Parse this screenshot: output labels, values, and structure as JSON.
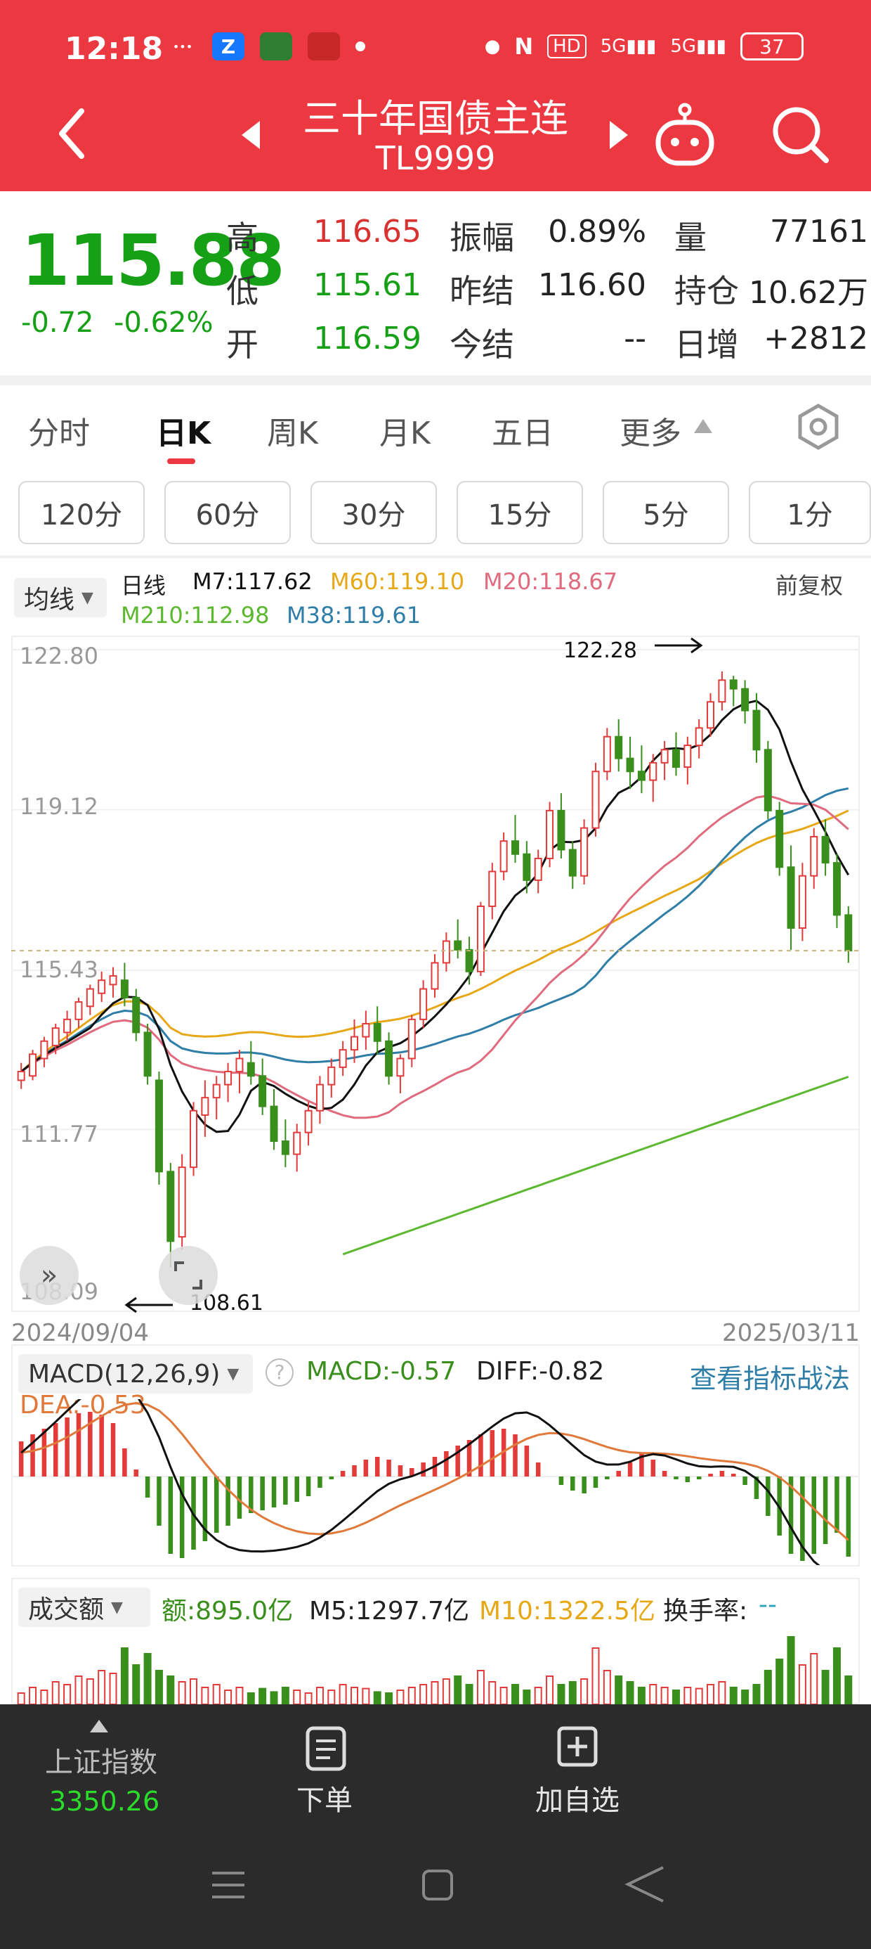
{
  "status": {
    "time": "12:18",
    "battery": "37",
    "icons": [
      "xiaohongshu-icon",
      "alipay-icon",
      "app-icon",
      "app-icon-2"
    ]
  },
  "header": {
    "title": "三十年国债主连",
    "code": "TL9999"
  },
  "quote": {
    "price": "115.88",
    "change": "-0.72",
    "change_pct": "-0.62%",
    "high_label": "高",
    "high": "116.65",
    "low_label": "低",
    "low": "115.61",
    "open_label": "开",
    "open": "116.59",
    "amp_label": "振幅",
    "amp": "0.89%",
    "prev_settle_label": "昨结",
    "prev_settle": "116.60",
    "settle_label": "今结",
    "settle": "--",
    "vol_label": "量",
    "vol": "77161",
    "oi_label": "持仓",
    "oi": "10.62万",
    "daily_inc_label": "日增",
    "daily_inc": "+2812"
  },
  "tabs": [
    "分时",
    "日K",
    "周K",
    "月K",
    "五日",
    "更多"
  ],
  "intervals": [
    "120分",
    "60分",
    "30分",
    "15分",
    "5分",
    "1分"
  ],
  "ma": {
    "selector": "均线",
    "period": "日线",
    "m7": "M7:117.62",
    "m60": "M60:119.10",
    "m20": "M20:118.67",
    "m210": "M210:112.98",
    "m38": "M38:119.61",
    "adjust": "前复权"
  },
  "colors": {
    "up": "#e33a3a",
    "down": "#3a8f1c",
    "m7": "#111111",
    "m20": "#e06a7e",
    "m38": "#2f7ea8",
    "m60": "#e6a817",
    "m210": "#5cb82f",
    "accent": "#ec3841"
  },
  "chart_data": [
    {
      "type": "line",
      "subtype": "candlestick",
      "x_start": "2024/09/04",
      "x_end": "2025/03/11",
      "y_ticks": [
        "122.80",
        "119.12",
        "115.43",
        "111.77",
        "108.09"
      ],
      "ylim": [
        108.09,
        122.8
      ],
      "last_price": 115.88,
      "annotations": [
        {
          "text": "122.28",
          "type": "high"
        },
        {
          "text": "108.61",
          "type": "low"
        }
      ],
      "candles": [
        [
          112.9,
          113.3,
          112.7,
          113.1
        ],
        [
          113.0,
          113.6,
          112.9,
          113.5
        ],
        [
          113.4,
          113.9,
          113.2,
          113.8
        ],
        [
          113.7,
          114.2,
          113.5,
          114.1
        ],
        [
          114.0,
          114.5,
          113.8,
          114.3
        ],
        [
          114.3,
          114.8,
          114.1,
          114.7
        ],
        [
          114.6,
          115.1,
          114.4,
          115.0
        ],
        [
          114.9,
          115.4,
          114.7,
          115.2
        ],
        [
          115.1,
          115.5,
          114.8,
          115.3
        ],
        [
          115.2,
          115.6,
          114.6,
          114.8
        ],
        [
          114.8,
          115.0,
          113.8,
          114.0
        ],
        [
          114.0,
          114.2,
          112.8,
          113.0
        ],
        [
          112.9,
          113.1,
          110.5,
          110.8
        ],
        [
          110.8,
          111.0,
          108.6,
          109.2
        ],
        [
          109.3,
          111.2,
          109.0,
          110.9
        ],
        [
          110.9,
          112.4,
          110.7,
          112.2
        ],
        [
          112.1,
          112.9,
          111.6,
          112.5
        ],
        [
          112.5,
          113.0,
          112.0,
          112.8
        ],
        [
          112.8,
          113.3,
          112.4,
          113.1
        ],
        [
          113.1,
          113.6,
          112.6,
          113.4
        ],
        [
          113.3,
          113.8,
          112.8,
          113.0
        ],
        [
          113.0,
          113.4,
          112.1,
          112.3
        ],
        [
          112.3,
          112.7,
          111.3,
          111.5
        ],
        [
          111.5,
          112.0,
          110.9,
          111.2
        ],
        [
          111.2,
          111.9,
          110.8,
          111.7
        ],
        [
          111.7,
          112.4,
          111.4,
          112.2
        ],
        [
          112.2,
          113.0,
          111.9,
          112.8
        ],
        [
          112.8,
          113.4,
          112.5,
          113.2
        ],
        [
          113.2,
          113.8,
          113.0,
          113.6
        ],
        [
          113.6,
          114.3,
          113.3,
          113.9
        ],
        [
          113.9,
          114.5,
          113.6,
          114.2
        ],
        [
          114.2,
          114.6,
          113.5,
          113.8
        ],
        [
          113.8,
          114.0,
          112.8,
          113.0
        ],
        [
          113.0,
          113.5,
          112.6,
          113.4
        ],
        [
          113.4,
          114.4,
          113.2,
          114.3
        ],
        [
          114.3,
          115.2,
          114.1,
          115.0
        ],
        [
          115.0,
          115.8,
          114.8,
          115.6
        ],
        [
          115.6,
          116.3,
          115.4,
          116.1
        ],
        [
          116.1,
          116.6,
          115.7,
          115.9
        ],
        [
          115.9,
          116.2,
          115.1,
          115.4
        ],
        [
          115.4,
          117.0,
          115.3,
          116.9
        ],
        [
          116.9,
          117.9,
          116.6,
          117.7
        ],
        [
          117.7,
          118.6,
          117.5,
          118.4
        ],
        [
          118.4,
          119.0,
          117.9,
          118.1
        ],
        [
          118.1,
          118.4,
          117.2,
          117.5
        ],
        [
          117.5,
          118.2,
          117.2,
          118.0
        ],
        [
          118.0,
          119.3,
          117.8,
          119.1
        ],
        [
          119.1,
          119.5,
          118.0,
          118.2
        ],
        [
          118.2,
          118.4,
          117.3,
          117.6
        ],
        [
          117.6,
          118.9,
          117.4,
          118.7
        ],
        [
          118.7,
          120.2,
          118.5,
          120.0
        ],
        [
          120.0,
          121.0,
          119.8,
          120.8
        ],
        [
          120.8,
          121.2,
          120.0,
          120.3
        ],
        [
          120.3,
          120.8,
          119.6,
          120.0
        ],
        [
          120.0,
          120.6,
          119.5,
          119.8
        ],
        [
          119.8,
          120.4,
          119.3,
          120.2
        ],
        [
          120.2,
          120.7,
          119.8,
          120.5
        ],
        [
          120.5,
          120.9,
          119.9,
          120.1
        ],
        [
          120.1,
          120.8,
          119.7,
          120.6
        ],
        [
          120.6,
          121.2,
          120.3,
          121.0
        ],
        [
          121.0,
          121.8,
          120.8,
          121.6
        ],
        [
          121.6,
          122.3,
          121.4,
          122.1
        ],
        [
          122.1,
          122.2,
          121.5,
          121.9
        ],
        [
          121.9,
          122.1,
          121.1,
          121.4
        ],
        [
          121.4,
          121.8,
          120.2,
          120.5
        ],
        [
          120.5,
          120.7,
          118.9,
          119.1
        ],
        [
          119.1,
          119.3,
          117.6,
          117.8
        ],
        [
          117.8,
          118.3,
          115.9,
          116.4
        ],
        [
          116.4,
          117.9,
          116.1,
          117.6
        ],
        [
          117.6,
          118.7,
          117.3,
          118.5
        ],
        [
          118.5,
          118.9,
          117.6,
          117.9
        ],
        [
          117.9,
          118.1,
          116.4,
          116.7
        ],
        [
          116.7,
          116.9,
          115.6,
          115.88
        ]
      ],
      "m7_end": 117.62,
      "m20_end": 118.67,
      "m38_end": 119.61,
      "m60_end": 119.1,
      "m210_end": 112.98
    },
    {
      "type": "bar",
      "title": "MACD(12,26,9)",
      "macd": "MACD:-0.57",
      "diff": "DIFF:-0.82",
      "dea": "DEA:-0.53",
      "link": "查看指标战法",
      "macd_values": [
        0.25,
        0.3,
        0.34,
        0.38,
        0.42,
        0.45,
        0.46,
        0.44,
        0.38,
        0.2,
        0.05,
        -0.15,
        -0.35,
        -0.55,
        -0.58,
        -0.52,
        -0.46,
        -0.4,
        -0.35,
        -0.3,
        -0.26,
        -0.24,
        -0.22,
        -0.2,
        -0.18,
        -0.14,
        -0.08,
        -0.02,
        0.04,
        0.08,
        0.12,
        0.14,
        0.12,
        0.08,
        0.06,
        0.1,
        0.14,
        0.18,
        0.22,
        0.26,
        0.3,
        0.33,
        0.34,
        0.3,
        0.22,
        0.1,
        0.0,
        -0.06,
        -0.1,
        -0.12,
        -0.08,
        -0.02,
        0.04,
        0.1,
        0.16,
        0.12,
        0.04,
        -0.02,
        -0.04,
        -0.02,
        0.02,
        0.04,
        0.02,
        -0.06,
        -0.16,
        -0.28,
        -0.42,
        -0.55,
        -0.6,
        -0.55,
        -0.48,
        -0.4,
        -0.57
      ]
    },
    {
      "type": "bar",
      "title": "成交额",
      "amount": "额:895.0亿",
      "m5": "M5:1297.7亿",
      "m10": "M10:1322.5亿",
      "turnover_label": "换手率:",
      "turnover": "--"
    }
  ],
  "nav": {
    "index_name": "上证指数",
    "index_value": "3350.26",
    "order": "下单",
    "add_watch": "加自选"
  }
}
